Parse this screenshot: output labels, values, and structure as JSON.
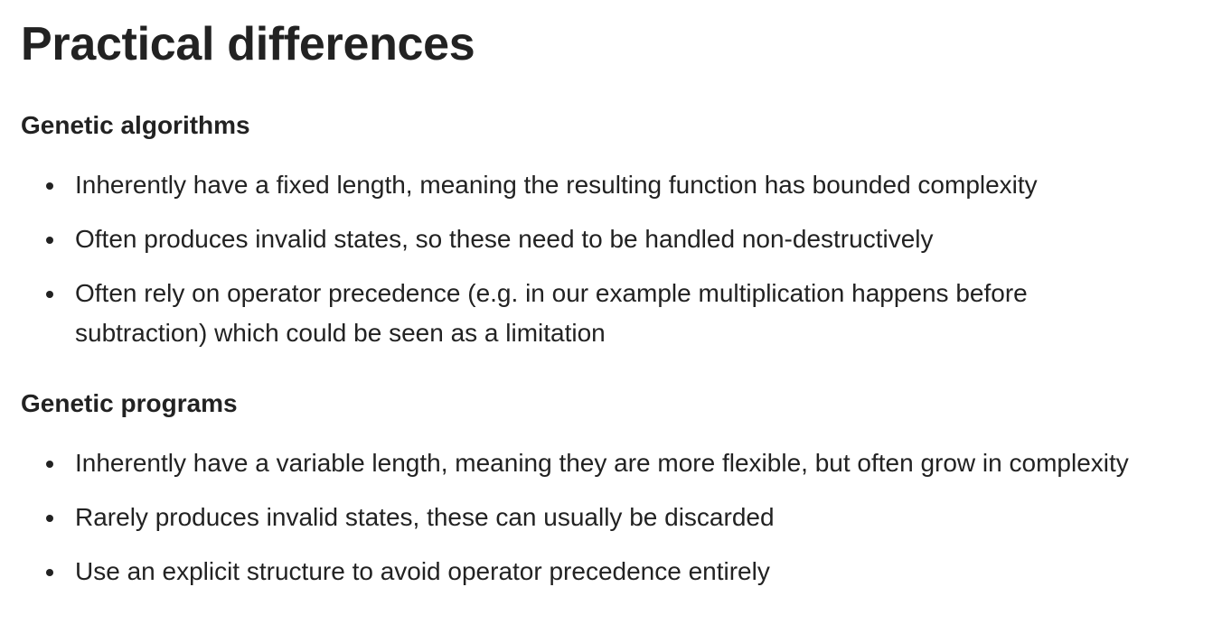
{
  "page": {
    "title": "Practical differences"
  },
  "sections": [
    {
      "heading": "Genetic algorithms",
      "items": [
        "Inherently have a fixed length, meaning the resulting function has bounded complexity",
        "Often produces invalid states, so these need to be handled non-destructively",
        "Often rely on operator precedence (e.g. in our example multiplication happens before subtraction) which could be seen as a limitation"
      ]
    },
    {
      "heading": "Genetic programs",
      "items": [
        "Inherently have a variable length, meaning they are more flexible, but often grow in complexity",
        "Rarely produces invalid states, these can usually be discarded",
        "Use an explicit structure to avoid operator precedence entirely"
      ]
    }
  ]
}
